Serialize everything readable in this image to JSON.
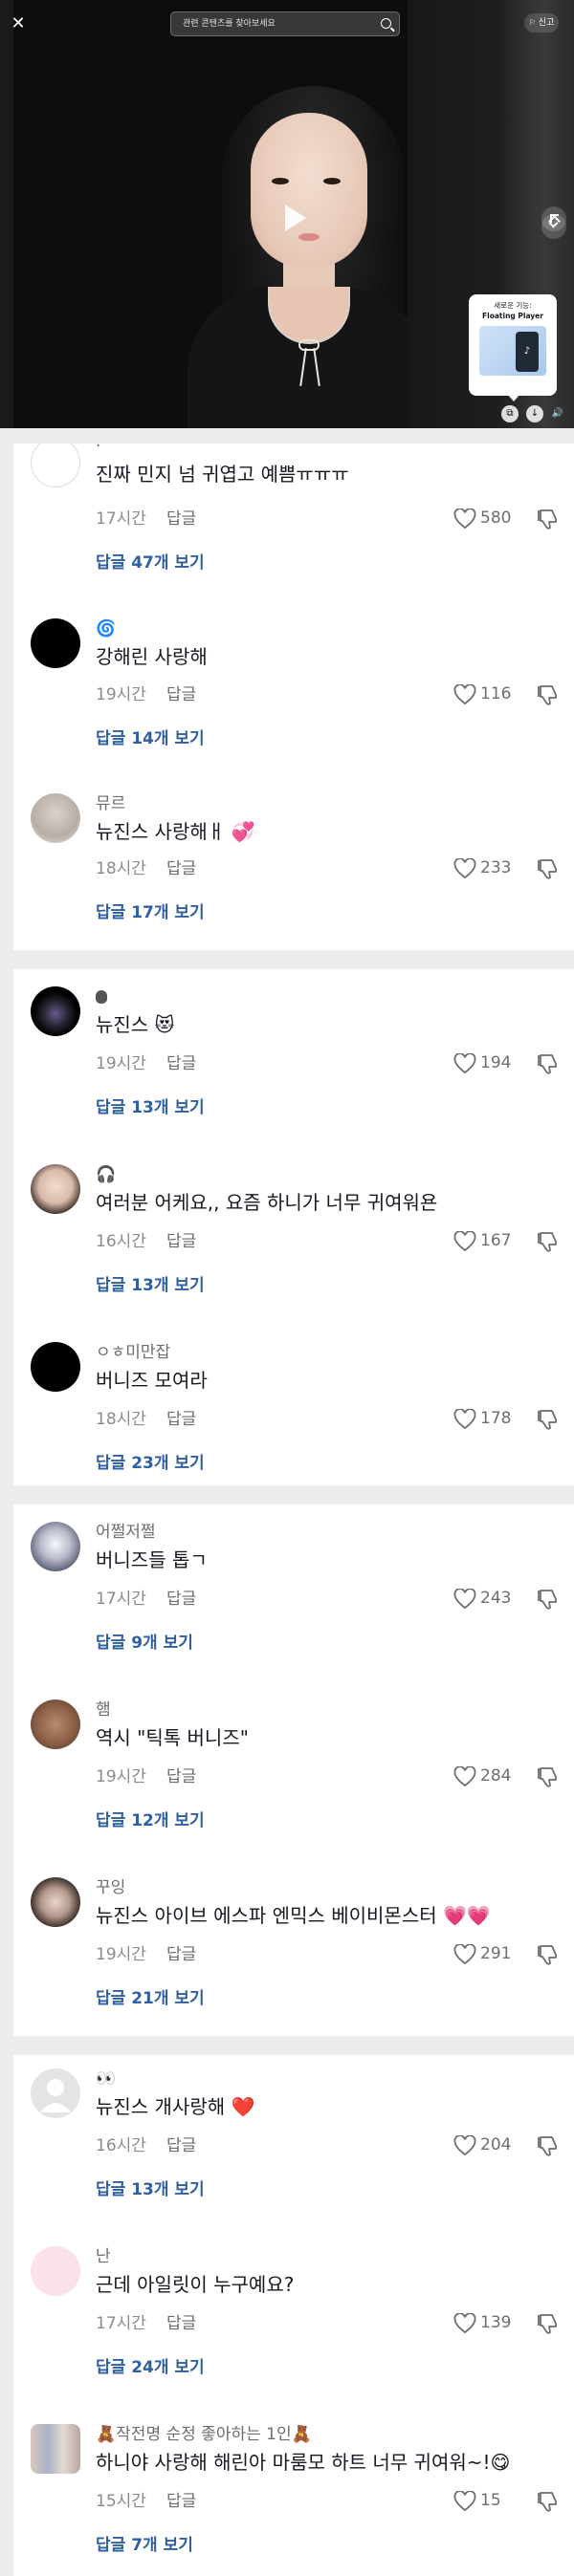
{
  "player": {
    "close_label": "✕",
    "search_placeholder": "관련 콘텐츠를 찾아보세요",
    "report_label": "신고",
    "popup_title": "새로운 기능:",
    "popup_subtitle": "Floating Player"
  },
  "cards": [
    {
      "comments": [
        {
          "username": "·",
          "text": "진짜 민지 넘 귀엽고 예쁨ㅠㅠㅠ",
          "time": "17시간",
          "reply_label": "답글",
          "likes": "580",
          "view_replies": "답글 47개 보기"
        },
        {
          "username": "🌀",
          "text": "강해린 사랑해",
          "time": "19시간",
          "reply_label": "답글",
          "likes": "116",
          "view_replies": "답글 14개 보기"
        },
        {
          "username": "뮤르",
          "text": "뉴진스 사랑해ㅐ 💞",
          "time": "18시간",
          "reply_label": "답글",
          "likes": "233",
          "view_replies": "답글 17개 보기"
        }
      ]
    },
    {
      "comments": [
        {
          "username": "",
          "text": "뉴진스 😻",
          "time": "19시간",
          "reply_label": "답글",
          "likes": "194",
          "view_replies": "답글 13개 보기"
        },
        {
          "username": "🎧",
          "text": "여러분 어케요,, 요즘 하니가 너무 귀여워욘",
          "time": "16시간",
          "reply_label": "답글",
          "likes": "167",
          "view_replies": "답글 13개 보기"
        },
        {
          "username": "ㅇㅎ미만잡",
          "text": "버니즈 모여라",
          "time": "18시간",
          "reply_label": "답글",
          "likes": "178",
          "view_replies": "답글 23개 보기"
        }
      ]
    },
    {
      "comments": [
        {
          "username": "어쩔저쩔",
          "text": "버니즈들 톱ㄱ",
          "time": "17시간",
          "reply_label": "답글",
          "likes": "243",
          "view_replies": "답글 9개 보기"
        },
        {
          "username": "햄",
          "text": "역시 \"틱톡 버니즈\"",
          "time": "19시간",
          "reply_label": "답글",
          "likes": "284",
          "view_replies": "답글 12개 보기"
        },
        {
          "username": "꾸잉",
          "text": "뉴진스 아이브 에스파 엔믹스 베이비몬스터 💗💗",
          "time": "19시간",
          "reply_label": "답글",
          "likes": "291",
          "view_replies": "답글 21개 보기"
        }
      ]
    },
    {
      "comments": [
        {
          "username": "👀",
          "text": "뉴진스 개사랑해 ❤️",
          "time": "16시간",
          "reply_label": "답글",
          "likes": "204",
          "view_replies": "답글 13개 보기"
        },
        {
          "username": "난",
          "text": "근데 아일릿이 누구예요?",
          "time": "17시간",
          "reply_label": "답글",
          "likes": "139",
          "view_replies": "답글 24개 보기"
        },
        {
          "username": "🧸작전명 순정 좋아하는 1인🧸",
          "text": "하니야 사랑해 해린아 마룸모 하트 너무 귀여워~!😋",
          "time": "15시간",
          "reply_label": "답글",
          "likes": "15",
          "view_replies": "답글 7개 보기"
        }
      ]
    }
  ],
  "colors": {
    "link_blue": "#2f5f9e",
    "muted_text": "#8a8b91",
    "background_gap": "#ececec"
  }
}
